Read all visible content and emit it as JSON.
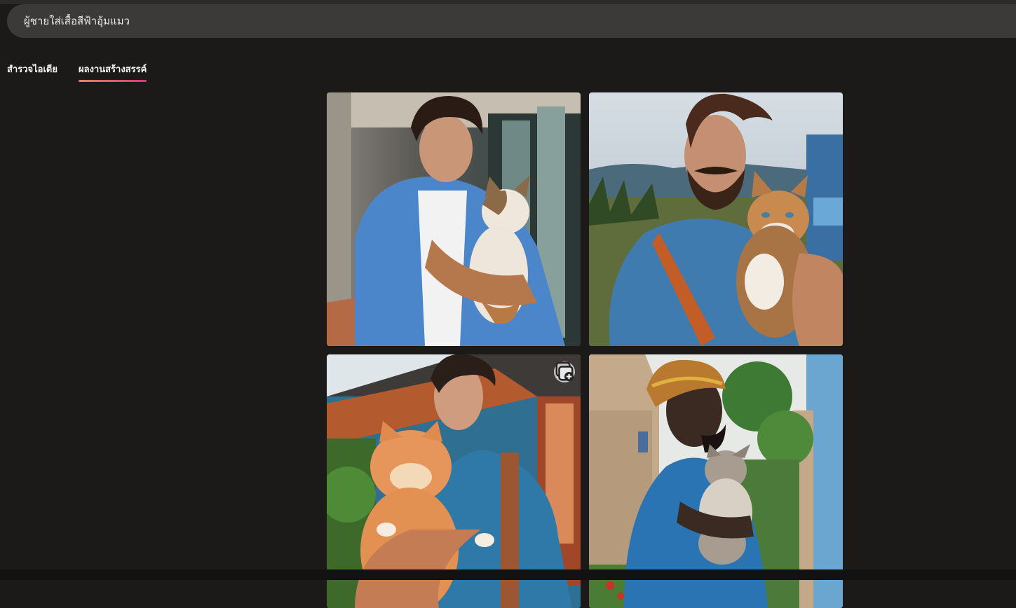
{
  "search": {
    "value": "ผู้ชายใส่เสื้อสีฟ้าอุ้มแมว"
  },
  "tabs": [
    {
      "label": "สำรวจไอเดีย",
      "active": false
    },
    {
      "label": "ผลงานสร้างสรรค์",
      "active": true
    }
  ],
  "images": [
    {
      "icon": "man-holding-calico-cat-image"
    },
    {
      "icon": "bearded-man-holding-tabby-cat-image"
    },
    {
      "icon": "man-holding-orange-cat-image",
      "badge_icon": "collection-add-icon"
    },
    {
      "icon": "man-in-kufi-holding-kitten-image"
    }
  ],
  "colors": {
    "background": "#1b1a19",
    "search_bg": "#3b3a39",
    "tab_underline_start": "#f0805a",
    "tab_underline_end": "#e0347e"
  }
}
